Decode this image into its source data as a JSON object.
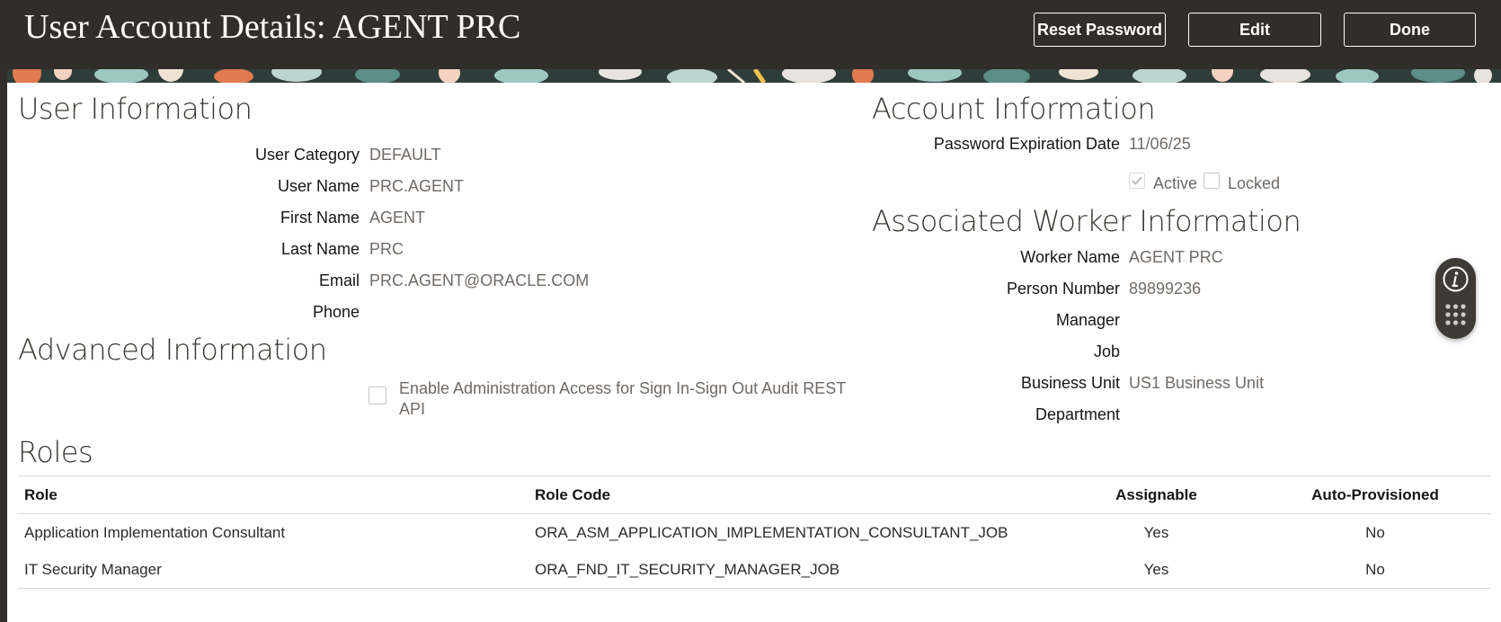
{
  "header": {
    "title": "User Account Details: AGENT PRC",
    "buttons": {
      "reset_password": "Reset Password",
      "edit": "Edit",
      "done": "Done"
    }
  },
  "user_information": {
    "title": "User Information",
    "fields": [
      {
        "label": "User Category",
        "value": "DEFAULT"
      },
      {
        "label": "User Name",
        "value": "PRC.AGENT"
      },
      {
        "label": "First Name",
        "value": "AGENT"
      },
      {
        "label": "Last Name",
        "value": "PRC"
      },
      {
        "label": "Email",
        "value": "PRC.AGENT@ORACLE.COM"
      },
      {
        "label": "Phone",
        "value": ""
      }
    ]
  },
  "advanced_information": {
    "title": "Advanced Information",
    "admin_access_label": "Enable Administration Access for Sign In-Sign Out Audit REST API",
    "admin_access_checked": false
  },
  "account_information": {
    "title": "Account Information",
    "password_expiration_label": "Password Expiration Date",
    "password_expiration_value": "11/06/25",
    "active_label": "Active",
    "active_checked": true,
    "locked_label": "Locked",
    "locked_checked": false
  },
  "worker_information": {
    "title": "Associated Worker Information",
    "fields": [
      {
        "label": "Worker Name",
        "value": "AGENT PRC"
      },
      {
        "label": "Person Number",
        "value": "89899236"
      },
      {
        "label": "Manager",
        "value": ""
      },
      {
        "label": "Job",
        "value": ""
      },
      {
        "label": "Business Unit",
        "value": "US1 Business Unit"
      },
      {
        "label": "Department",
        "value": ""
      }
    ]
  },
  "roles": {
    "title": "Roles",
    "columns": [
      "Role",
      "Role Code",
      "Assignable",
      "Auto-Provisioned"
    ],
    "rows": [
      [
        "Application Implementation Consultant",
        "ORA_ASM_APPLICATION_IMPLEMENTATION_CONSULTANT_JOB",
        "Yes",
        "No"
      ],
      [
        "IT Security Manager",
        "ORA_FND_IT_SECURITY_MANAGER_JOB",
        "Yes",
        "No"
      ]
    ]
  },
  "floating_toolbar": {
    "icons": [
      "info-icon",
      "keypad-icon"
    ]
  },
  "colors": {
    "header_bg": "#312d2a",
    "label_text": "#161513",
    "value_text": "#6f6a66"
  }
}
